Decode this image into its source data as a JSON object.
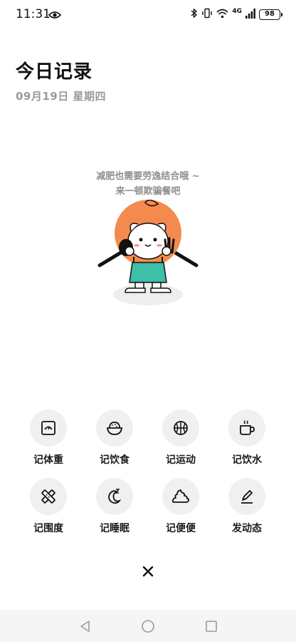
{
  "status_bar": {
    "time": "11:31",
    "network": "4G",
    "battery": "98"
  },
  "header": {
    "title": "今日记录",
    "date": "09月19日 星期四"
  },
  "empty_state": {
    "line1": "减肥也需要劳逸结合哦 ~",
    "line2": "来一顿欺骗餐吧"
  },
  "actions": [
    {
      "label": "记体重",
      "icon": "scale-icon"
    },
    {
      "label": "记饮食",
      "icon": "rice-bowl-icon"
    },
    {
      "label": "记运动",
      "icon": "basketball-icon"
    },
    {
      "label": "记饮水",
      "icon": "cup-icon"
    },
    {
      "label": "记围度",
      "icon": "measuring-tape-icon"
    },
    {
      "label": "记睡眠",
      "icon": "sleep-moon-icon"
    },
    {
      "label": "记便便",
      "icon": "poop-icon"
    },
    {
      "label": "发动态",
      "icon": "pen-icon"
    }
  ],
  "colors": {
    "mascot_orange": "#F58A4E",
    "mascot_teal": "#3DBFA8",
    "icon_circle": "#F0F0F0",
    "nav_bar": "#F5F5F5"
  }
}
